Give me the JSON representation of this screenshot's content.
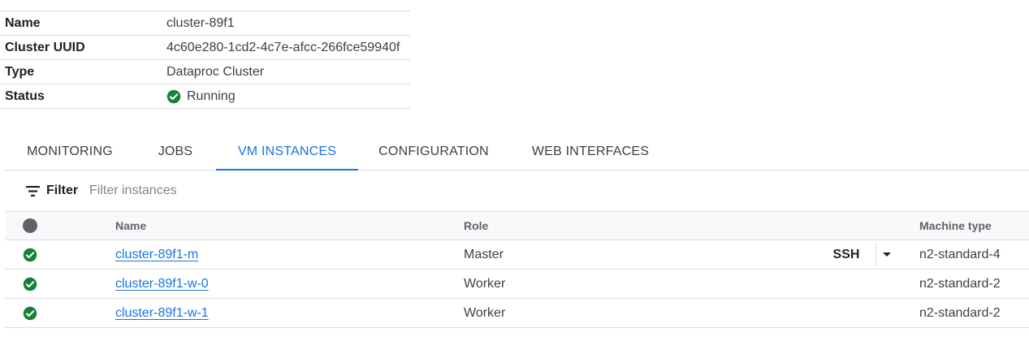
{
  "details": [
    {
      "label": "Name",
      "value": "cluster-89f1"
    },
    {
      "label": "Cluster UUID",
      "value": "4c60e280-1cd2-4c7e-afcc-266fce59940f"
    },
    {
      "label": "Type",
      "value": "Dataproc Cluster"
    },
    {
      "label": "Status",
      "value": "Running",
      "icon": "check-circle-icon"
    }
  ],
  "tabs": [
    {
      "label": "MONITORING"
    },
    {
      "label": "JOBS"
    },
    {
      "label": "VM INSTANCES",
      "active": true
    },
    {
      "label": "CONFIGURATION"
    },
    {
      "label": "WEB INTERFACES"
    }
  ],
  "filter": {
    "label": "Filter",
    "placeholder": "Filter instances",
    "icon": "filter-icon"
  },
  "table": {
    "headers": {
      "status": "",
      "name": "Name",
      "role": "Role",
      "machine_type": "Machine type"
    },
    "rows": [
      {
        "name": "cluster-89f1-m",
        "role": "Master",
        "ssh": "SSH",
        "machine_type": "n2-standard-4"
      },
      {
        "name": "cluster-89f1-w-0",
        "role": "Worker",
        "machine_type": "n2-standard-2"
      },
      {
        "name": "cluster-89f1-w-1",
        "role": "Worker",
        "machine_type": "n2-standard-2"
      }
    ]
  },
  "colors": {
    "accent": "#1a73e8",
    "success": "#188038",
    "border": "#dadce0",
    "header_bg": "#f8f9fa"
  }
}
